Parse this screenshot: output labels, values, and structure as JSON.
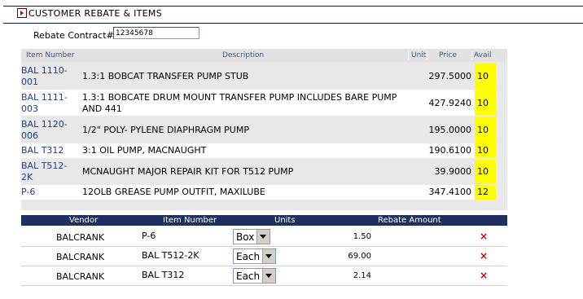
{
  "header": {
    "title": "CUSTOMER REBATE & ITEMS"
  },
  "contract": {
    "label": "Rebate Contract#",
    "value": "12345678"
  },
  "items": {
    "columns": [
      "Item Number",
      "Description",
      "Unit",
      "Price",
      "Avail"
    ],
    "rows": [
      {
        "item": "BAL 1110-001",
        "description": "1.3:1 BOBCAT TRANSFER PUMP STUB",
        "unit": "",
        "price": "297.5000",
        "avail": "10"
      },
      {
        "item": "BAL 1111-003",
        "description": "1.3:1 BOBCATE DRUM MOUNT TRANSFER PUMP INCLUDES BARE PUMP AND 441",
        "unit": "",
        "price": "427.9240",
        "avail": "10"
      },
      {
        "item": "BAL 1120-006",
        "description": "1/2\" POLY- PYLENE DIAPHRAGM PUMP",
        "unit": "",
        "price": "195.0000",
        "avail": "10"
      },
      {
        "item": "BAL T312",
        "description": "3:1 OIL PUMP, MACNAUGHT",
        "unit": "",
        "price": "190.6100",
        "avail": "10"
      },
      {
        "item": "BAL T512-2K",
        "description": "MCNAUGHT MAJOR REPAIR KIT FOR T512 PUMP",
        "unit": "",
        "price": "39.9000",
        "avail": "10"
      },
      {
        "item": "P-6",
        "description": "12OLB GREASE PUMP OUTFIT, MAXILUBE",
        "unit": "",
        "price": "347.4100",
        "avail": "12"
      }
    ]
  },
  "vendor_table": {
    "columns": [
      "Vendor",
      "Item Number",
      "Units",
      "Rebate Amount"
    ],
    "rows": [
      {
        "vendor": "BALCRANK",
        "item": "P-6",
        "units": "Box",
        "amount": "1.50"
      },
      {
        "vendor": "BALCRANK",
        "item": "BAL T512-2K",
        "units": "Each",
        "amount": "69.00"
      },
      {
        "vendor": "BALCRANK",
        "item": "BAL T312",
        "units": "Each",
        "amount": "2.14"
      }
    ],
    "delete_icon": "×"
  },
  "colors": {
    "header_bar": "#1f2f5f",
    "avail_highlight": "#ffff00",
    "link": "#1f3f8f",
    "delete": "#e00000"
  }
}
